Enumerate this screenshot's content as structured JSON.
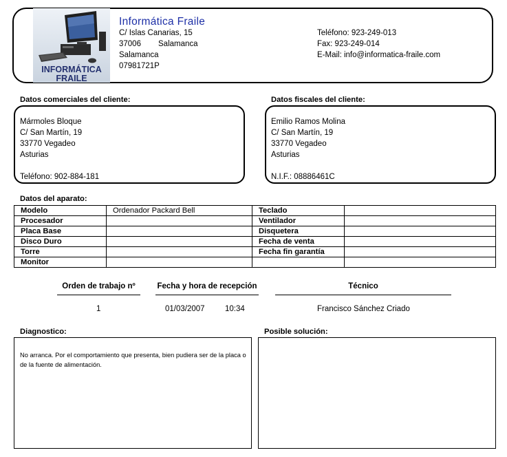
{
  "company": {
    "name": "Informática Fraile",
    "address": "C/ Islas Canarias, 15",
    "postal_code": "37006",
    "city": "Salamanca",
    "province": "Salamanca",
    "cif": "07981721P",
    "phone": "Teléfono: 923-249-013",
    "fax": "Fax: 923-249-014",
    "email": "E-Mail: info@informatica-fraile.com",
    "logo_text_1": "INFORMÁTICA",
    "logo_text_2": "FRAILE",
    "logo_icon": "computer-icon",
    "brand_color": "#1d2fa6"
  },
  "commercial": {
    "title": "Datos comerciales del cliente:",
    "name": "Mármoles Bloque",
    "address": "C/ San Martín, 19",
    "city": "33770 Vegadeo",
    "province": "Asturias",
    "phone": "Teléfono: 902-884-181"
  },
  "fiscal": {
    "title": "Datos fiscales del cliente:",
    "name": "Emilio Ramos Molina",
    "address": "C/ San Martín, 19",
    "city": "33770 Vegadeo",
    "province": "Asturias",
    "nif": "N.I.F.: 08886461C"
  },
  "device": {
    "title": "Datos del aparato:",
    "rows": [
      {
        "l1": "Modelo",
        "v1": "Ordenador Packard Bell",
        "l2": "Teclado",
        "v2": ""
      },
      {
        "l1": "Procesador",
        "v1": "",
        "l2": "Ventilador",
        "v2": ""
      },
      {
        "l1": "Placa Base",
        "v1": "",
        "l2": "Disquetera",
        "v2": ""
      },
      {
        "l1": "Disco Duro",
        "v1": "",
        "l2": "Fecha de venta",
        "v2": ""
      },
      {
        "l1": "Torre",
        "v1": "",
        "l2": "Fecha fin garantía",
        "v2": ""
      },
      {
        "l1": "Monitor",
        "v1": "",
        "l2": "",
        "v2": ""
      }
    ]
  },
  "work": {
    "order_label": "Orden de trabajo nº",
    "date_label": "Fecha y hora de recepción",
    "tech_label": "Técnico",
    "order": "1",
    "date": "01/03/2007",
    "time": "10:34",
    "technician": "Francisco Sánchez Criado"
  },
  "diagnosis": {
    "title": "Diagnostico:",
    "text": "No arranca. Por el comportamiento que presenta, bien pudiera ser de la placa o de la fuente de alimentación."
  },
  "solution": {
    "title": "Posible solución:",
    "text": ""
  }
}
